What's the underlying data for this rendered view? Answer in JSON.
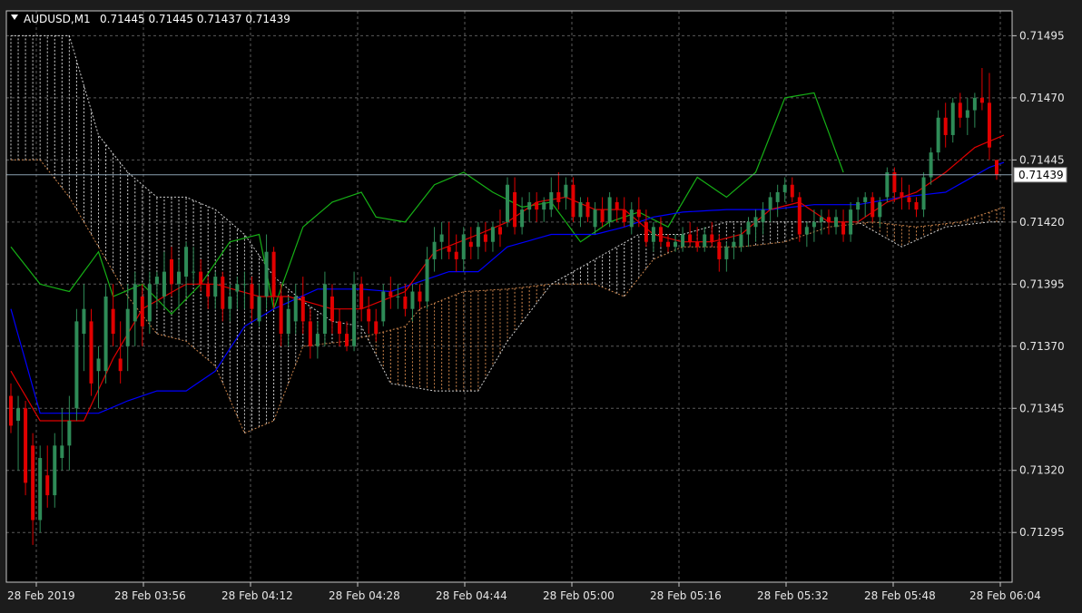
{
  "header": {
    "symbol": "AUDUSD,M1",
    "ohlc": "0.71445 0.71445 0.71437 0.71439"
  },
  "price_axis": {
    "ticks": [
      "0.71495",
      "0.71470",
      "0.71445",
      "0.71420",
      "0.71395",
      "0.71370",
      "0.71345",
      "0.71320",
      "0.71295"
    ],
    "current_price_label": "0.71439"
  },
  "time_axis": {
    "ticks": [
      "28 Feb 2019",
      "28 Feb 03:56",
      "28 Feb 04:12",
      "28 Feb 04:28",
      "28 Feb 04:44",
      "28 Feb 05:00",
      "28 Feb 05:16",
      "28 Feb 05:32",
      "28 Feb 05:48",
      "28 Feb 06:04"
    ]
  },
  "colors": {
    "background": "#000000",
    "grid": "#5a5a5a",
    "bull": "#2e8b57",
    "bear": "#e10000",
    "tenkan": "#e00000",
    "kijun": "#0000ff",
    "chikou": "#16b016",
    "cloud_bull": "#d0d0d0",
    "cloud_bear": "#c8824a",
    "current_line": "#8aa0b0",
    "axis_text": "#e6e6e6"
  },
  "chart_data": {
    "type": "candlestick",
    "indicator": "Ichimoku",
    "ylim": [
      0.71275,
      0.71505
    ],
    "y_ticks": [
      0.71495,
      0.7147,
      0.71445,
      0.7142,
      0.71395,
      0.7137,
      0.71345,
      0.7132,
      0.71295
    ],
    "current_price": 0.71439,
    "candles": [
      [
        0.7135,
        0.71355,
        0.71335,
        0.71338
      ],
      [
        0.7134,
        0.7135,
        0.7132,
        0.71345
      ],
      [
        0.71345,
        0.71348,
        0.7131,
        0.71315
      ],
      [
        0.7133,
        0.71335,
        0.7129,
        0.713
      ],
      [
        0.713,
        0.7133,
        0.71295,
        0.71325
      ],
      [
        0.71318,
        0.7133,
        0.71305,
        0.7131
      ],
      [
        0.7131,
        0.71335,
        0.71305,
        0.7133
      ],
      [
        0.71325,
        0.71345,
        0.7132,
        0.7133
      ],
      [
        0.7133,
        0.7135,
        0.7132,
        0.7134
      ],
      [
        0.71345,
        0.71385,
        0.7134,
        0.7138
      ],
      [
        0.71375,
        0.71395,
        0.7136,
        0.71385
      ],
      [
        0.7138,
        0.71385,
        0.7135,
        0.71355
      ],
      [
        0.7136,
        0.7137,
        0.71345,
        0.71365
      ],
      [
        0.7136,
        0.71395,
        0.71355,
        0.7139
      ],
      [
        0.71385,
        0.71395,
        0.7137,
        0.71375
      ],
      [
        0.71365,
        0.7138,
        0.71355,
        0.7136
      ],
      [
        0.7137,
        0.71395,
        0.7136,
        0.71385
      ],
      [
        0.7138,
        0.714,
        0.7137,
        0.71395
      ],
      [
        0.7139,
        0.71395,
        0.7137,
        0.71378
      ],
      [
        0.7138,
        0.714,
        0.71375,
        0.71395
      ],
      [
        0.71395,
        0.714,
        0.71385,
        0.71398
      ],
      [
        0.7139,
        0.71408,
        0.71385,
        0.714
      ],
      [
        0.71405,
        0.7141,
        0.7139,
        0.71395
      ],
      [
        0.71395,
        0.71405,
        0.71385,
        0.714
      ],
      [
        0.71398,
        0.71412,
        0.7139,
        0.7141
      ],
      [
        0.714,
        0.7141,
        0.71395,
        0.714
      ],
      [
        0.714,
        0.71405,
        0.71392,
        0.71395
      ],
      [
        0.71395,
        0.71398,
        0.71385,
        0.7139
      ],
      [
        0.7139,
        0.714,
        0.71385,
        0.71398
      ],
      [
        0.71398,
        0.714,
        0.7138,
        0.71385
      ],
      [
        0.71385,
        0.71395,
        0.7138,
        0.7139
      ],
      [
        0.71392,
        0.71398,
        0.71385,
        0.71395
      ],
      [
        0.71395,
        0.714,
        0.71385,
        0.71395
      ],
      [
        0.71395,
        0.71398,
        0.7138,
        0.71385
      ],
      [
        0.7138,
        0.71395,
        0.71378,
        0.7139
      ],
      [
        0.7139,
        0.71415,
        0.71385,
        0.71408
      ],
      [
        0.71408,
        0.7141,
        0.71385,
        0.7139
      ],
      [
        0.7139,
        0.71395,
        0.7137,
        0.71375
      ],
      [
        0.71375,
        0.7139,
        0.7137,
        0.71385
      ],
      [
        0.7138,
        0.71395,
        0.71375,
        0.7139
      ],
      [
        0.7139,
        0.71398,
        0.71375,
        0.7138
      ],
      [
        0.7138,
        0.71385,
        0.71365,
        0.7137
      ],
      [
        0.7137,
        0.7138,
        0.71365,
        0.71375
      ],
      [
        0.71375,
        0.714,
        0.7137,
        0.71395
      ],
      [
        0.7139,
        0.71395,
        0.71375,
        0.7138
      ],
      [
        0.7138,
        0.71385,
        0.7137,
        0.71375
      ],
      [
        0.71375,
        0.7138,
        0.71368,
        0.7137
      ],
      [
        0.7137,
        0.714,
        0.71368,
        0.71395
      ],
      [
        0.71395,
        0.71398,
        0.7138,
        0.71385
      ],
      [
        0.71385,
        0.7139,
        0.71375,
        0.7138
      ],
      [
        0.7138,
        0.71385,
        0.71372,
        0.71375
      ],
      [
        0.7138,
        0.71395,
        0.71378,
        0.71392
      ],
      [
        0.71392,
        0.71398,
        0.71385,
        0.7139
      ],
      [
        0.7139,
        0.71395,
        0.71385,
        0.7139
      ],
      [
        0.7139,
        0.71395,
        0.71382,
        0.71385
      ],
      [
        0.71385,
        0.71395,
        0.7138,
        0.71392
      ],
      [
        0.71392,
        0.71395,
        0.71385,
        0.71388
      ],
      [
        0.71388,
        0.7141,
        0.71385,
        0.71405
      ],
      [
        0.71405,
        0.71418,
        0.714,
        0.71412
      ],
      [
        0.71412,
        0.7142,
        0.71405,
        0.71415
      ],
      [
        0.7141,
        0.7142,
        0.71405,
        0.71408
      ],
      [
        0.71408,
        0.71415,
        0.714,
        0.71405
      ],
      [
        0.71405,
        0.71418,
        0.714,
        0.71415
      ],
      [
        0.71412,
        0.71418,
        0.71405,
        0.7141
      ],
      [
        0.7141,
        0.7142,
        0.71405,
        0.71418
      ],
      [
        0.71415,
        0.7142,
        0.71408,
        0.71412
      ],
      [
        0.71412,
        0.7142,
        0.71408,
        0.71418
      ],
      [
        0.71418,
        0.71425,
        0.7141,
        0.71415
      ],
      [
        0.7142,
        0.71438,
        0.71418,
        0.71435
      ],
      [
        0.71432,
        0.71438,
        0.71415,
        0.71418
      ],
      [
        0.71418,
        0.7143,
        0.71415,
        0.71425
      ],
      [
        0.71425,
        0.71432,
        0.7142,
        0.71428
      ],
      [
        0.71428,
        0.71432,
        0.7142,
        0.71425
      ],
      [
        0.71425,
        0.7143,
        0.7142,
        0.71428
      ],
      [
        0.71425,
        0.71438,
        0.71422,
        0.71432
      ],
      [
        0.71432,
        0.7144,
        0.71425,
        0.71428
      ],
      [
        0.7143,
        0.71438,
        0.71425,
        0.71435
      ],
      [
        0.71435,
        0.71438,
        0.7142,
        0.71422
      ],
      [
        0.71422,
        0.7143,
        0.71418,
        0.71428
      ],
      [
        0.71428,
        0.7143,
        0.7142,
        0.71422
      ],
      [
        0.71418,
        0.71428,
        0.71415,
        0.71425
      ],
      [
        0.71425,
        0.7143,
        0.71418,
        0.7142
      ],
      [
        0.7142,
        0.71432,
        0.71418,
        0.7143
      ],
      [
        0.71428,
        0.7143,
        0.7142,
        0.71425
      ],
      [
        0.71425,
        0.7143,
        0.71418,
        0.7142
      ],
      [
        0.71418,
        0.71428,
        0.71415,
        0.71425
      ],
      [
        0.71425,
        0.7143,
        0.71418,
        0.71422
      ],
      [
        0.7142,
        0.71425,
        0.7141,
        0.71412
      ],
      [
        0.71412,
        0.7142,
        0.71408,
        0.71418
      ],
      [
        0.71418,
        0.71422,
        0.7141,
        0.71412
      ],
      [
        0.71412,
        0.71415,
        0.71408,
        0.7141
      ],
      [
        0.7141,
        0.71415,
        0.71408,
        0.71412
      ],
      [
        0.7141,
        0.71418,
        0.71408,
        0.71415
      ],
      [
        0.71415,
        0.7142,
        0.7141,
        0.71412
      ],
      [
        0.71412,
        0.71418,
        0.71408,
        0.7141
      ],
      [
        0.7141,
        0.71418,
        0.71408,
        0.71415
      ],
      [
        0.71415,
        0.7142,
        0.7141,
        0.71412
      ],
      [
        0.71412,
        0.71415,
        0.714,
        0.71405
      ],
      [
        0.71405,
        0.71412,
        0.714,
        0.7141
      ],
      [
        0.7141,
        0.71415,
        0.71405,
        0.71412
      ],
      [
        0.7141,
        0.71418,
        0.71408,
        0.71415
      ],
      [
        0.71415,
        0.71422,
        0.7141,
        0.7142
      ],
      [
        0.71418,
        0.71425,
        0.71412,
        0.71422
      ],
      [
        0.7142,
        0.71428,
        0.71415,
        0.71425
      ],
      [
        0.71425,
        0.71432,
        0.7142,
        0.7143
      ],
      [
        0.71428,
        0.71435,
        0.71422,
        0.71432
      ],
      [
        0.71432,
        0.71438,
        0.71428,
        0.71435
      ],
      [
        0.71435,
        0.71438,
        0.71428,
        0.7143
      ],
      [
        0.7143,
        0.71432,
        0.71412,
        0.71415
      ],
      [
        0.71415,
        0.7142,
        0.7141,
        0.71418
      ],
      [
        0.71418,
        0.71425,
        0.71412,
        0.7142
      ],
      [
        0.7142,
        0.71425,
        0.71415,
        0.71422
      ],
      [
        0.71422,
        0.71425,
        0.71415,
        0.7142
      ],
      [
        0.71418,
        0.71425,
        0.71415,
        0.71422
      ],
      [
        0.7142,
        0.71425,
        0.71412,
        0.71415
      ],
      [
        0.71415,
        0.71428,
        0.71412,
        0.71425
      ],
      [
        0.71425,
        0.7143,
        0.7142,
        0.71428
      ],
      [
        0.71428,
        0.71432,
        0.71422,
        0.7143
      ],
      [
        0.7143,
        0.71432,
        0.7142,
        0.71422
      ],
      [
        0.71422,
        0.7143,
        0.71418,
        0.71428
      ],
      [
        0.7143,
        0.71442,
        0.71428,
        0.7144
      ],
      [
        0.7144,
        0.71442,
        0.71428,
        0.71432
      ],
      [
        0.71432,
        0.71438,
        0.71425,
        0.7143
      ],
      [
        0.7143,
        0.71435,
        0.71425,
        0.71428
      ],
      [
        0.71428,
        0.7143,
        0.71422,
        0.71425
      ],
      [
        0.71425,
        0.7144,
        0.71422,
        0.71438
      ],
      [
        0.71438,
        0.7145,
        0.71435,
        0.71448
      ],
      [
        0.71448,
        0.71465,
        0.71445,
        0.71462
      ],
      [
        0.71462,
        0.71468,
        0.7145,
        0.71455
      ],
      [
        0.71455,
        0.7147,
        0.71452,
        0.71468
      ],
      [
        0.71468,
        0.71472,
        0.71458,
        0.71462
      ],
      [
        0.71462,
        0.7147,
        0.71455,
        0.71465
      ],
      [
        0.71465,
        0.71472,
        0.71458,
        0.7147
      ],
      [
        0.7147,
        0.71482,
        0.71465,
        0.71468
      ],
      [
        0.71468,
        0.7148,
        0.71445,
        0.7145
      ],
      [
        0.71445,
        0.71445,
        0.71437,
        0.71439
      ]
    ],
    "tenkan": [
      [
        0,
        0.7136
      ],
      [
        4,
        0.7134
      ],
      [
        10,
        0.7134
      ],
      [
        14,
        0.71365
      ],
      [
        18,
        0.71385
      ],
      [
        24,
        0.71395
      ],
      [
        28,
        0.71395
      ],
      [
        34,
        0.7139
      ],
      [
        38,
        0.7139
      ],
      [
        44,
        0.71385
      ],
      [
        48,
        0.71385
      ],
      [
        54,
        0.71392
      ],
      [
        58,
        0.71408
      ],
      [
        64,
        0.71415
      ],
      [
        68,
        0.7142
      ],
      [
        72,
        0.71428
      ],
      [
        76,
        0.7143
      ],
      [
        80,
        0.71425
      ],
      [
        84,
        0.71425
      ],
      [
        88,
        0.71415
      ],
      [
        92,
        0.71412
      ],
      [
        96,
        0.71412
      ],
      [
        100,
        0.71415
      ],
      [
        104,
        0.71425
      ],
      [
        108,
        0.71428
      ],
      [
        112,
        0.7142
      ],
      [
        116,
        0.7142
      ],
      [
        120,
        0.71428
      ],
      [
        124,
        0.71432
      ],
      [
        128,
        0.7144
      ],
      [
        132,
        0.7145
      ],
      [
        136,
        0.71455
      ],
      [
        140,
        0.7146
      ]
    ],
    "kijun": [
      [
        0,
        0.71385
      ],
      [
        4,
        0.71343
      ],
      [
        12,
        0.71343
      ],
      [
        16,
        0.71348
      ],
      [
        20,
        0.71352
      ],
      [
        24,
        0.71352
      ],
      [
        28,
        0.7136
      ],
      [
        32,
        0.71378
      ],
      [
        36,
        0.71385
      ],
      [
        42,
        0.71393
      ],
      [
        48,
        0.71393
      ],
      [
        52,
        0.71392
      ],
      [
        56,
        0.71396
      ],
      [
        60,
        0.714
      ],
      [
        64,
        0.714
      ],
      [
        68,
        0.7141
      ],
      [
        74,
        0.71415
      ],
      [
        80,
        0.71415
      ],
      [
        84,
        0.71418
      ],
      [
        88,
        0.71422
      ],
      [
        92,
        0.71424
      ],
      [
        98,
        0.71425
      ],
      [
        104,
        0.71425
      ],
      [
        110,
        0.71427
      ],
      [
        116,
        0.71427
      ],
      [
        122,
        0.7143
      ],
      [
        128,
        0.71432
      ],
      [
        134,
        0.71442
      ],
      [
        138,
        0.71446
      ],
      [
        140,
        0.71444
      ]
    ],
    "chikou": [
      [
        0,
        0.7141
      ],
      [
        4,
        0.71395
      ],
      [
        8,
        0.71392
      ],
      [
        12,
        0.71408
      ],
      [
        14,
        0.7139
      ],
      [
        18,
        0.71395
      ],
      [
        22,
        0.71383
      ],
      [
        26,
        0.71395
      ],
      [
        30,
        0.71412
      ],
      [
        34,
        0.71415
      ],
      [
        36,
        0.71385
      ],
      [
        40,
        0.71418
      ],
      [
        44,
        0.71428
      ],
      [
        48,
        0.71432
      ],
      [
        50,
        0.71422
      ],
      [
        54,
        0.7142
      ],
      [
        58,
        0.71435
      ],
      [
        62,
        0.7144
      ],
      [
        66,
        0.71432
      ],
      [
        70,
        0.71426
      ],
      [
        74,
        0.71428
      ],
      [
        78,
        0.71412
      ],
      [
        82,
        0.7142
      ],
      [
        86,
        0.71424
      ],
      [
        90,
        0.71418
      ],
      [
        94,
        0.71438
      ],
      [
        98,
        0.7143
      ],
      [
        102,
        0.7144
      ],
      [
        106,
        0.7147
      ],
      [
        110,
        0.71472
      ],
      [
        114,
        0.7144
      ]
    ],
    "span_a": [
      [
        0,
        0.71445
      ],
      [
        4,
        0.71445
      ],
      [
        8,
        0.7143
      ],
      [
        12,
        0.7141
      ],
      [
        16,
        0.7139
      ],
      [
        20,
        0.71375
      ],
      [
        24,
        0.71372
      ],
      [
        28,
        0.71362
      ],
      [
        32,
        0.71335
      ],
      [
        36,
        0.7134
      ],
      [
        40,
        0.7137
      ],
      [
        46,
        0.71372
      ],
      [
        50,
        0.71375
      ],
      [
        54,
        0.71378
      ],
      [
        56,
        0.71385
      ],
      [
        62,
        0.71392
      ],
      [
        68,
        0.71393
      ],
      [
        74,
        0.71395
      ],
      [
        80,
        0.71395
      ],
      [
        84,
        0.7139
      ],
      [
        88,
        0.71405
      ],
      [
        92,
        0.7141
      ],
      [
        96,
        0.7141
      ],
      [
        100,
        0.7141
      ],
      [
        106,
        0.71412
      ],
      [
        112,
        0.71418
      ],
      [
        118,
        0.7142
      ],
      [
        124,
        0.71418
      ],
      [
        130,
        0.7142
      ],
      [
        136,
        0.71426
      ],
      [
        140,
        0.71423
      ],
      [
        144,
        0.71423
      ]
    ],
    "span_b": [
      [
        0,
        0.71495
      ],
      [
        8,
        0.71495
      ],
      [
        12,
        0.71455
      ],
      [
        16,
        0.7144
      ],
      [
        20,
        0.7143
      ],
      [
        24,
        0.7143
      ],
      [
        28,
        0.71425
      ],
      [
        32,
        0.71415
      ],
      [
        36,
        0.71398
      ],
      [
        40,
        0.71388
      ],
      [
        44,
        0.7138
      ],
      [
        48,
        0.71378
      ],
      [
        52,
        0.71355
      ],
      [
        58,
        0.71352
      ],
      [
        64,
        0.71352
      ],
      [
        68,
        0.71372
      ],
      [
        74,
        0.71395
      ],
      [
        80,
        0.71405
      ],
      [
        86,
        0.71415
      ],
      [
        92,
        0.71415
      ],
      [
        98,
        0.7142
      ],
      [
        104,
        0.7142
      ],
      [
        110,
        0.7142
      ],
      [
        116,
        0.7142
      ],
      [
        122,
        0.7141
      ],
      [
        128,
        0.71418
      ],
      [
        134,
        0.7142
      ],
      [
        140,
        0.7142
      ],
      [
        144,
        0.7142
      ]
    ]
  }
}
